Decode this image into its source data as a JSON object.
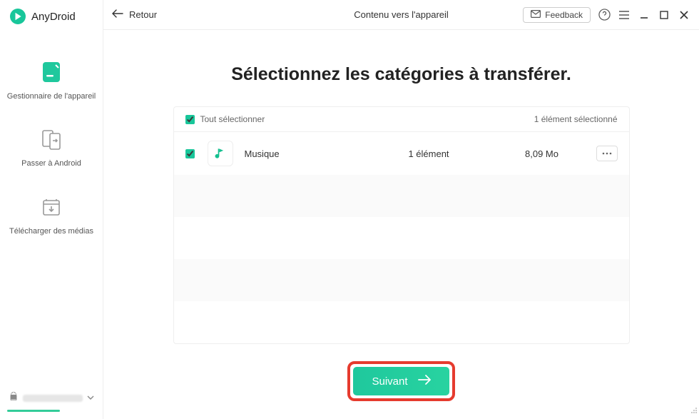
{
  "brand": {
    "name": "AnyDroid"
  },
  "sidebar": {
    "items": [
      {
        "label": "Gestionnaire de l'appareil"
      },
      {
        "label": "Passer à Android"
      },
      {
        "label": "Télécharger des médias"
      }
    ]
  },
  "topbar": {
    "back": "Retour",
    "title": "Contenu vers l'appareil",
    "feedback": "Feedback"
  },
  "headline": "Sélectionnez les catégories à transférer.",
  "panel": {
    "selectAll": "Tout sélectionner",
    "selectedCount": "1 élément sélectionné",
    "rows": [
      {
        "name": "Musique",
        "count": "1 élément",
        "size": "8,09 Mo"
      }
    ]
  },
  "nextLabel": "Suivant",
  "colors": {
    "accent": "#18c69a",
    "highlight": "#e63b2e"
  }
}
